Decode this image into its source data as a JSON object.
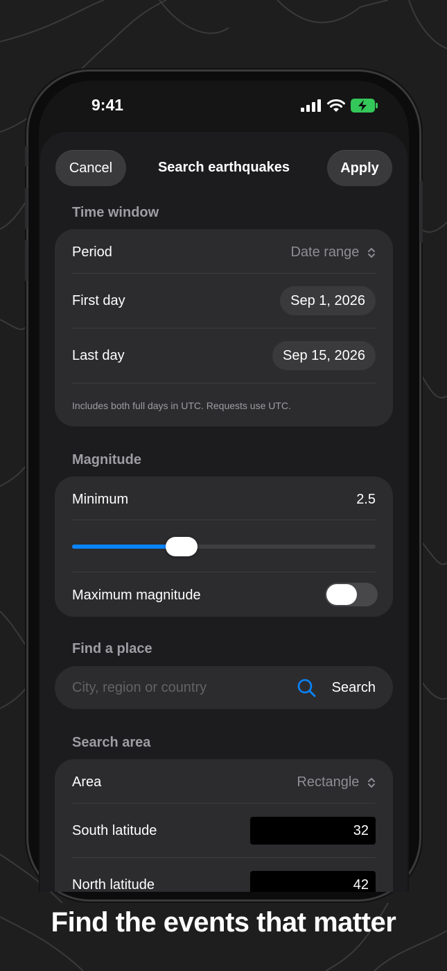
{
  "status_bar": {
    "time": "9:41",
    "icons": [
      "cellular-signal-icon",
      "wifi-icon",
      "battery-charging-icon"
    ]
  },
  "nav": {
    "cancel_label": "Cancel",
    "title": "Search earthquakes",
    "apply_label": "Apply"
  },
  "time_window": {
    "header": "Time window",
    "period_label": "Period",
    "period_value": "Date range",
    "first_day_label": "First day",
    "first_day_value": "Sep 1, 2026",
    "last_day_label": "Last day",
    "last_day_value": "Sep 15, 2026",
    "footnote": "Includes both full days in UTC. Requests use UTC."
  },
  "magnitude": {
    "header": "Magnitude",
    "minimum_label": "Minimum",
    "minimum_value": "2.5",
    "slider_fraction": 0.36,
    "maximum_label": "Maximum magnitude",
    "maximum_enabled": false
  },
  "find_place": {
    "header": "Find a place",
    "placeholder": "City, region or country",
    "search_label": "Search"
  },
  "search_area": {
    "header": "Search area",
    "area_label": "Area",
    "area_value": "Rectangle",
    "south_label": "South latitude",
    "south_value": "32",
    "north_label": "North latitude",
    "north_value": "42"
  },
  "caption": "Find the events that matter",
  "colors": {
    "accent": "#0a84ff",
    "battery": "#34c759",
    "background": "#1e1e1e",
    "card": "#2c2c2e"
  }
}
